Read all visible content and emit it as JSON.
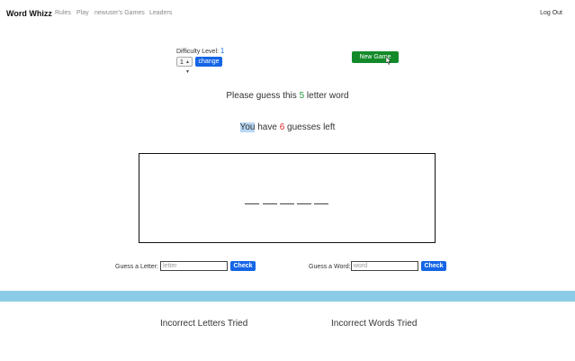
{
  "nav": {
    "brand": "Word Whizz",
    "links": [
      "Rules",
      "Play",
      "newuser's Games",
      "Leaders"
    ],
    "logout": "Log Out"
  },
  "difficulty": {
    "label": "Difficulty Level:",
    "level": "1",
    "selected": "1",
    "change_label": "change"
  },
  "new_game_label": "New Game",
  "prompt": {
    "guess_prefix": "Please guess this",
    "word_length": "5",
    "guess_suffix": "letter word",
    "you": "You",
    "have": "have",
    "guesses_left": "6",
    "guesses_suffix": "guesses left"
  },
  "blanks": [
    "_",
    "_",
    "_",
    "_",
    "_"
  ],
  "letter_guess": {
    "label": "Guess a Letter:",
    "placeholder": "letter",
    "button": "Check"
  },
  "word_guess": {
    "label": "Guess a Word:",
    "placeholder": "word",
    "button": "Check"
  },
  "incorrect_letters_heading": "Incorrect Letters Tried",
  "incorrect_words_heading": "Incorrect Words Tried",
  "colors": {
    "primary": "#1565e6",
    "new_game": "#138a2a",
    "divider": "#8ccbe6",
    "length": "#1f9d3a",
    "guesses": "#e0262a"
  }
}
